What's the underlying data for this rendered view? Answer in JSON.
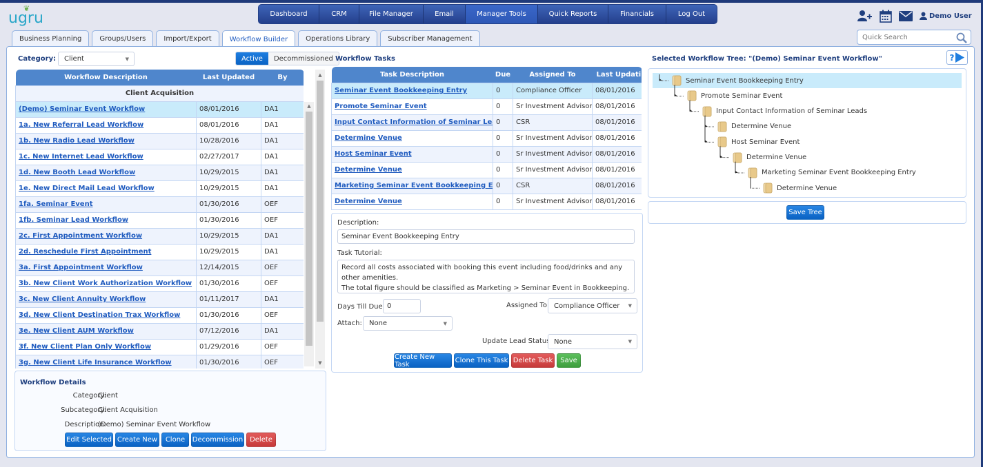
{
  "app": {
    "logo": "ugru"
  },
  "main_nav": {
    "items": [
      {
        "label": "Dashboard",
        "active": false
      },
      {
        "label": "CRM",
        "active": false
      },
      {
        "label": "File Manager",
        "active": false
      },
      {
        "label": "Email",
        "active": false
      },
      {
        "label": "Manager Tools",
        "active": true
      },
      {
        "label": "Quick Reports",
        "active": false
      },
      {
        "label": "Financials",
        "active": false
      },
      {
        "label": "Log Out",
        "active": false
      }
    ]
  },
  "header_icons": [
    "add-contact-icon",
    "calendar-icon",
    "mail-icon",
    "user-icon"
  ],
  "user": {
    "name": "Demo User"
  },
  "search": {
    "placeholder": "Quick Search"
  },
  "sub_tabs": [
    {
      "label": "Business Planning",
      "active": false
    },
    {
      "label": "Groups/Users",
      "active": false
    },
    {
      "label": "Import/Export",
      "active": false
    },
    {
      "label": "Workflow Builder",
      "active": true
    },
    {
      "label": "Operations Library",
      "active": false
    },
    {
      "label": "Subscriber Management",
      "active": false
    }
  ],
  "left": {
    "category_label": "Category:",
    "category_value": "Client",
    "status_toggle": {
      "active": "Active",
      "inactive": "Decommissioned",
      "selected": "Active"
    },
    "workflow_table": {
      "headers": [
        "Workflow Description",
        "Last Updated",
        "By"
      ],
      "group": "Client Acquisition",
      "rows": [
        {
          "desc": "(Demo) Seminar Event Workflow",
          "updated": "08/01/2016",
          "by": "DA1",
          "selected": true
        },
        {
          "desc": "1a. New Referral Lead Workflow",
          "updated": "08/01/2016",
          "by": "DA1"
        },
        {
          "desc": "1b. New Radio Lead Workflow",
          "updated": "10/28/2016",
          "by": "DA1"
        },
        {
          "desc": "1c. New Internet Lead Workflow",
          "updated": "02/27/2017",
          "by": "DA1"
        },
        {
          "desc": "1d. New Booth Lead Workflow",
          "updated": "10/29/2015",
          "by": "DA1"
        },
        {
          "desc": "1e. New Direct Mail Lead Workflow",
          "updated": "10/29/2015",
          "by": "DA1"
        },
        {
          "desc": "1fa. Seminar Event",
          "updated": "01/30/2016",
          "by": "OEF"
        },
        {
          "desc": "1fb. Seminar Lead Workflow",
          "updated": "01/30/2016",
          "by": "OEF"
        },
        {
          "desc": "2c. First Appointment Workflow",
          "updated": "10/29/2015",
          "by": "DA1"
        },
        {
          "desc": "2d. Reschedule First Appointment",
          "updated": "10/29/2015",
          "by": "DA1"
        },
        {
          "desc": "3a. First Appointment Workflow",
          "updated": "12/14/2015",
          "by": "OEF"
        },
        {
          "desc": "3b. New Client Work Authorization Workflow",
          "updated": "01/30/2016",
          "by": "OEF"
        },
        {
          "desc": "3c. New Client Annuity Workflow",
          "updated": "01/11/2017",
          "by": "DA1"
        },
        {
          "desc": "3d. New Client Destination Trax Workflow",
          "updated": "01/30/2016",
          "by": "OEF"
        },
        {
          "desc": "3e. New Client AUM Workflow",
          "updated": "07/12/2016",
          "by": "DA1"
        },
        {
          "desc": "3f. New Client Plan Only Workflow",
          "updated": "01/29/2016",
          "by": "OEF"
        },
        {
          "desc": "3g. New Client Life Insurance Workflow",
          "updated": "01/30/2016",
          "by": "OEF"
        }
      ]
    },
    "details": {
      "title": "Workflow Details",
      "category_label": "Category:",
      "category": "Client",
      "subcategory_label": "Subcategory:",
      "subcategory": "Client Acquisition",
      "description_label": "Description:",
      "description": "(Demo) Seminar Event Workflow",
      "buttons": {
        "edit": "Edit Selected",
        "create": "Create New",
        "clone": "Clone",
        "decommission": "Decommission",
        "delete": "Delete"
      }
    }
  },
  "middle": {
    "title": "Workflow Tasks",
    "task_table": {
      "headers": [
        "Task Description",
        "Due",
        "Assigned To",
        "Last Updati"
      ],
      "rows": [
        {
          "desc": "Seminar Event Bookkeeping Entry",
          "due": "0",
          "assigned": "Compliance Officer",
          "updated": "08/01/2016",
          "selected": true
        },
        {
          "desc": "Promote Seminar Event",
          "due": "0",
          "assigned": "Sr Investment Advisor",
          "updated": "08/01/2016"
        },
        {
          "desc": "Input Contact Information of Seminar Leads",
          "due": "0",
          "assigned": "CSR",
          "updated": "08/01/2016"
        },
        {
          "desc": "Determine Venue",
          "due": "0",
          "assigned": "Sr Investment Advisor",
          "updated": "08/01/2016"
        },
        {
          "desc": "Host Seminar Event",
          "due": "0",
          "assigned": "Sr Investment Advisor",
          "updated": "08/01/2016"
        },
        {
          "desc": "Determine Venue",
          "due": "0",
          "assigned": "Sr Investment Advisor",
          "updated": "08/01/2016"
        },
        {
          "desc": "Marketing Seminar Event Bookkeeping Entry",
          "due": "0",
          "assigned": "CSR",
          "updated": "08/01/2016"
        },
        {
          "desc": "Determine Venue",
          "due": "0",
          "assigned": "Sr Investment Advisor",
          "updated": "08/01/2016"
        }
      ]
    },
    "form": {
      "description_label": "Description:",
      "description_value": "Seminar Event Bookkeeping Entry",
      "tutorial_label": "Task Tutorial:",
      "tutorial_value": "Record all costs associated with booking this event including food/drinks and any other amenities.\nThe total figure should be classified as Marketing > Seminar Event in Bookkeeping.",
      "days_label": "Days Till Due:",
      "days_value": "0",
      "assigned_label": "Assigned To:",
      "assigned_value": "Compliance Officer",
      "attach_label": "Attach:",
      "attach_value": "None",
      "lead_status_label": "Update Lead Status:",
      "lead_status_value": "None",
      "buttons": {
        "create": "Create New Task",
        "clone": "Clone This Task",
        "delete": "Delete Task",
        "save": "Save"
      }
    }
  },
  "right": {
    "title": "Selected Workflow Tree: \"(Demo) Seminar Event Workflow\"",
    "help_label": "?",
    "tree": [
      {
        "label": "Seminar Event Bookkeeping Entry",
        "depth": 0,
        "selected": true
      },
      {
        "label": "Promote Seminar Event",
        "depth": 1
      },
      {
        "label": "Input Contact Information of Seminar Leads",
        "depth": 2
      },
      {
        "label": "Determine Venue",
        "depth": 3
      },
      {
        "label": "Host Seminar Event",
        "depth": 3
      },
      {
        "label": "Determine Venue",
        "depth": 4
      },
      {
        "label": "Marketing Seminar Event Bookkeeping Entry",
        "depth": 5
      },
      {
        "label": "Determine Venue",
        "depth": 6
      }
    ],
    "save_tree": "Save Tree"
  }
}
